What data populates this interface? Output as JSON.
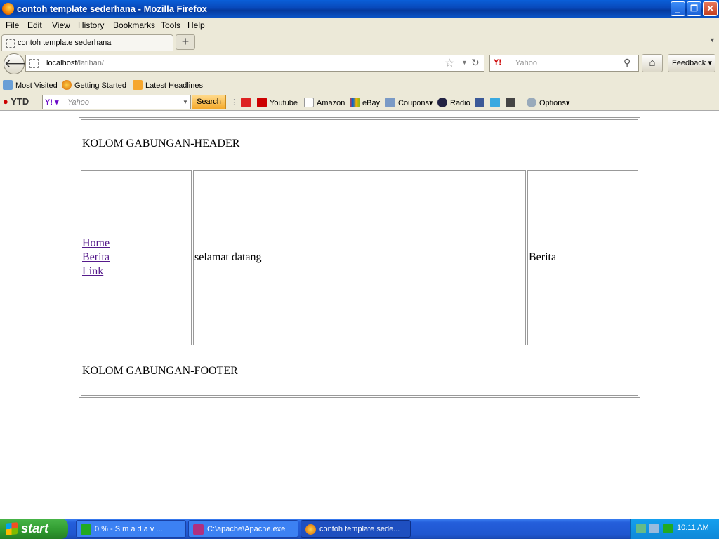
{
  "window": {
    "title": "contoh template sederhana - Mozilla Firefox"
  },
  "menu": {
    "items": [
      "File",
      "Edit",
      "View",
      "History",
      "Bookmarks",
      "Tools",
      "Help"
    ]
  },
  "tab": {
    "label": "contoh template sederhana"
  },
  "address": {
    "host": "localhost",
    "path": "/latihan/"
  },
  "search": {
    "engine": "Y!",
    "placeholder": "Yahoo"
  },
  "feedback": {
    "label": "Feedback"
  },
  "bookmarks": [
    "Most Visited",
    "Getting Started",
    "Latest Headlines"
  ],
  "ytd": {
    "logo": "YTD",
    "search_placeholder": "Yahoo",
    "search_button": "Search",
    "links": [
      "Youtube",
      "Amazon",
      "eBay",
      "Coupons",
      "Radio"
    ],
    "options": "Options"
  },
  "page": {
    "header": "KOLOM GABUNGAN-HEADER",
    "nav": [
      "Home",
      "Berita",
      "Link"
    ],
    "main": "selamat datang",
    "right": "Berita",
    "footer": "KOLOM GABUNGAN-FOOTER"
  },
  "taskbar": {
    "start": "start",
    "tasks": [
      "0 % - S m a d a v ...",
      "C:\\apache\\Apache.exe",
      "contoh template sede..."
    ],
    "clock": "10:11 AM"
  },
  "colors": {
    "titlebar": "#0847b8",
    "taskbar": "#245edb",
    "visited_link": "#551a8b",
    "start_button": "#2f9a2f"
  }
}
